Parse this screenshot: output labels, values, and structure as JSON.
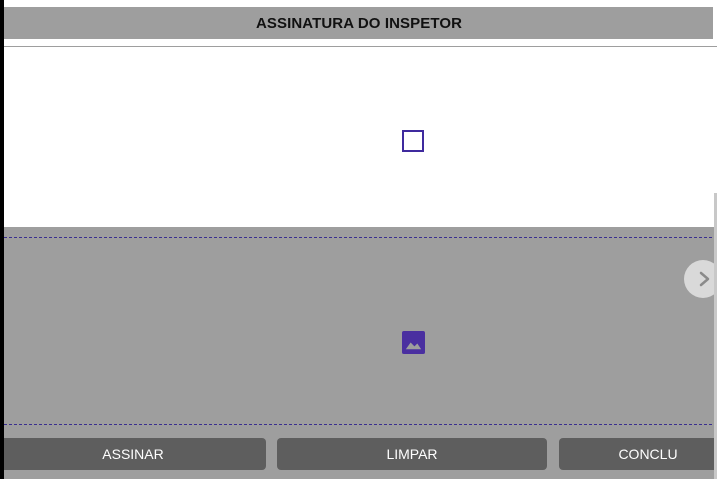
{
  "header": {
    "title": "ASSINATURA DO INSPETOR"
  },
  "checkbox": {
    "checked": false
  },
  "signature_pad": {
    "placeholder_icon": "image-icon"
  },
  "navigation": {
    "next_icon": "chevron-right-icon"
  },
  "buttons": {
    "sign_label": "ASSINAR",
    "clear_label": "LIMPAR",
    "finish_label": "CONCLU"
  },
  "colors": {
    "accent": "#3f2a9e",
    "panel_gray": "#9e9e9e",
    "button_gray": "#5e5e5e"
  }
}
